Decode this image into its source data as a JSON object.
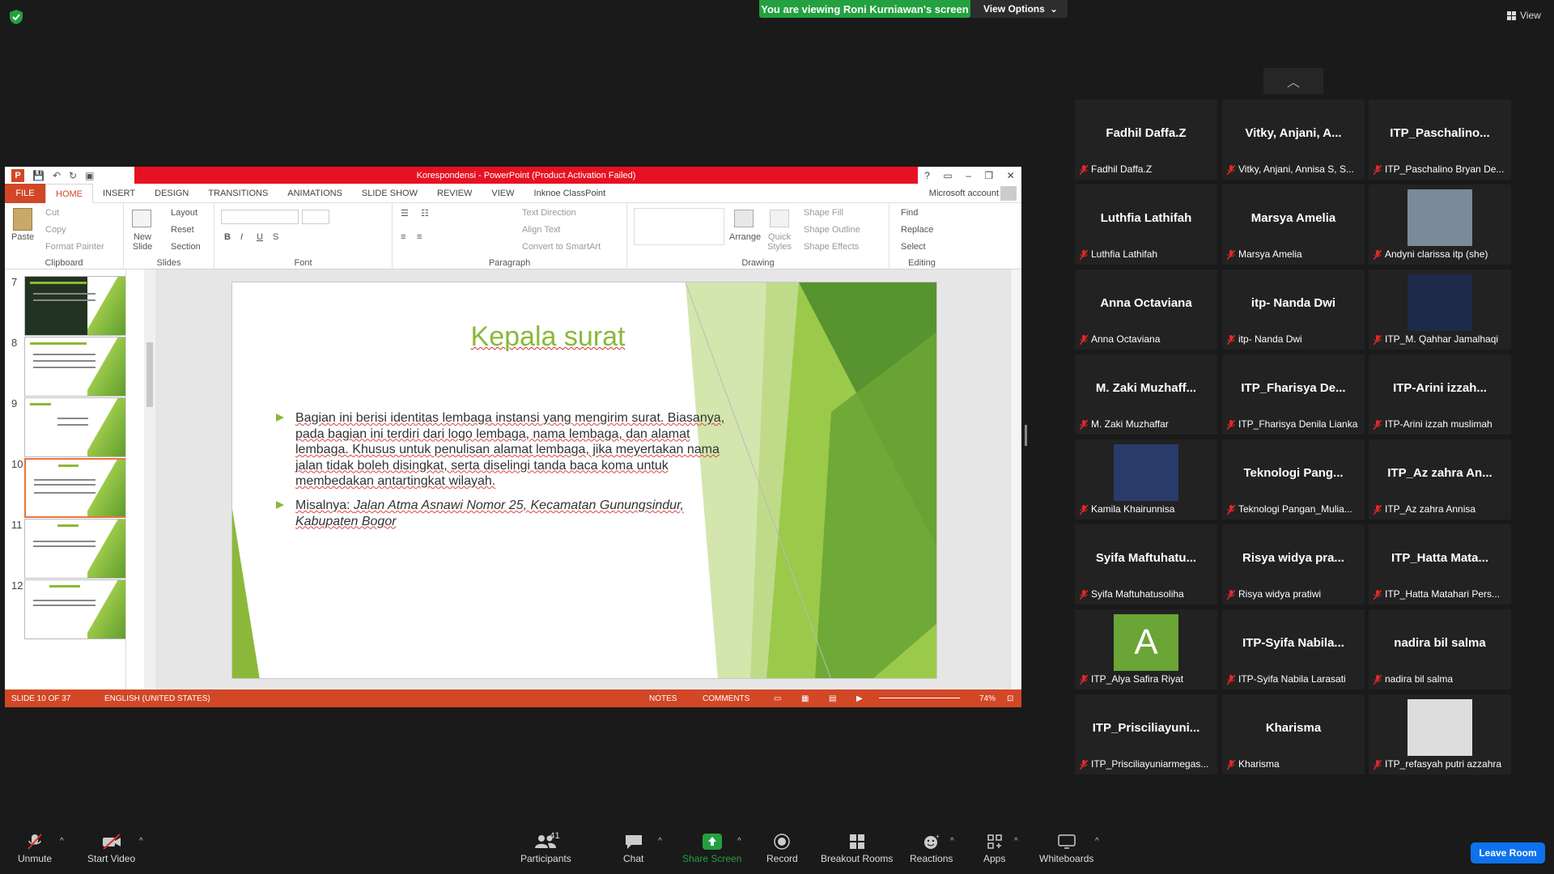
{
  "banner": {
    "viewing": "You are viewing Roni Kurniawan's screen",
    "view_options": "View Options",
    "view_label": "View"
  },
  "ppt": {
    "window_title": "Korespondensi - PowerPoint (Product Activation Failed)",
    "account": "Microsoft account",
    "tabs": [
      "FILE",
      "HOME",
      "INSERT",
      "DESIGN",
      "TRANSITIONS",
      "ANIMATIONS",
      "SLIDE SHOW",
      "REVIEW",
      "VIEW",
      "Inknoe ClassPoint"
    ],
    "ribbon": {
      "paste": "Paste",
      "cut": "Cut",
      "copy": "Copy",
      "format_painter": "Format Painter",
      "clipboard": "Clipboard",
      "new_slide": "New Slide",
      "layout": "Layout",
      "reset": "Reset",
      "section": "Section",
      "slides": "Slides",
      "font": "Font",
      "paragraph": "Paragraph",
      "text_direction": "Text Direction",
      "align_text": "Align Text",
      "convert_smartart": "Convert to SmartArt",
      "arrange": "Arrange",
      "quick_styles": "Quick Styles",
      "shape_fill": "Shape Fill",
      "shape_outline": "Shape Outline",
      "shape_effects": "Shape Effects",
      "drawing": "Drawing",
      "find": "Find",
      "replace": "Replace",
      "select": "Select",
      "editing": "Editing"
    },
    "thumb_numbers": [
      "7",
      "8",
      "9",
      "10",
      "11",
      "12"
    ],
    "slide": {
      "title": "Kepala surat",
      "bullet1": "Bagian ini berisi identitas lembaga instansi yang mengirim surat. Biasanya, pada bagian ini terdiri dari logo lembaga, nama lembaga, dan alamat lembaga. Khusus untuk penulisan alamat lembaga, jika meyertakan nama jalan tidak boleh disingkat, serta diselingi tanda baca koma untuk membedakan antartingkat wilayah.",
      "bullet2_prefix": "Misalnya: ",
      "bullet2_example": "Jalan Atma Asnawi Nomor 25, Kecamatan Gunungsindur, Kabupaten Bogor"
    },
    "status": {
      "slide": "SLIDE 10 OF 37",
      "language": "ENGLISH (UNITED STATES)",
      "notes": "NOTES",
      "comments": "COMMENTS",
      "zoom": "74%"
    }
  },
  "participants": [
    {
      "big": "Fadhil Daffa.Z",
      "name": "Fadhil Daffa.Z"
    },
    {
      "big": "Vitky, Anjani, A...",
      "name": "Vitky, Anjani, Annisa S, S..."
    },
    {
      "big": "ITP_Paschalino...",
      "name": "ITP_Paschalino Bryan De..."
    },
    {
      "big": "Luthfia Lathifah",
      "name": "Luthfia Lathifah"
    },
    {
      "big": "Marsya Amelia",
      "name": "Marsya Amelia"
    },
    {
      "big": "",
      "name": "Andyni clarissa itp (she)"
    },
    {
      "big": "Anna Octaviana",
      "name": "Anna Octaviana"
    },
    {
      "big": "itp- Nanda Dwi",
      "name": "itp- Nanda Dwi"
    },
    {
      "big": "",
      "name": "ITP_M. Qahhar Jamalhaqi"
    },
    {
      "big": "M. Zaki Muzhaff...",
      "name": "M. Zaki Muzhaffar"
    },
    {
      "big": "ITP_Fharisya De...",
      "name": "ITP_Fharisya Denila Lianka"
    },
    {
      "big": "ITP-Arini izzah...",
      "name": "ITP-Arini izzah muslimah"
    },
    {
      "big": "",
      "name": "Kamila Khairunnisa"
    },
    {
      "big": "Teknologi Pang...",
      "name": "Teknologi Pangan_Mulia..."
    },
    {
      "big": "ITP_Az zahra An...",
      "name": "ITP_Az zahra Annisa"
    },
    {
      "big": "Syifa Maftuhatu...",
      "name": "Syifa Maftuhatusoliha"
    },
    {
      "big": "Risya widya pra...",
      "name": "Risya widya pratiwi"
    },
    {
      "big": "ITP_Hatta Mata...",
      "name": "ITP_Hatta Matahari Pers..."
    },
    {
      "big": "A",
      "name": "ITP_Alya Safira Riyat"
    },
    {
      "big": "ITP-Syifa Nabila...",
      "name": "ITP-Syifa Nabila Larasati"
    },
    {
      "big": "nadira bil salma",
      "name": "nadira bil salma"
    },
    {
      "big": "ITP_Prisciliayuni...",
      "name": "ITP_Prisciliayuniarmegas..."
    },
    {
      "big": "Kharisma",
      "name": "Kharisma"
    },
    {
      "big": "",
      "name": "ITP_refasyah putri azzahra"
    }
  ],
  "toolbar": {
    "unmute": "Unmute",
    "start_video": "Start Video",
    "participants": "Participants",
    "participant_count": "41",
    "chat": "Chat",
    "share_screen": "Share Screen",
    "record": "Record",
    "breakout": "Breakout Rooms",
    "reactions": "Reactions",
    "apps": "Apps",
    "whiteboards": "Whiteboards",
    "leave": "Leave Room"
  },
  "colors": {
    "share_green": "#23a140",
    "ppt_orange": "#d24726",
    "slide_green": "#8cb83a",
    "leave_blue": "#0e72ed"
  }
}
